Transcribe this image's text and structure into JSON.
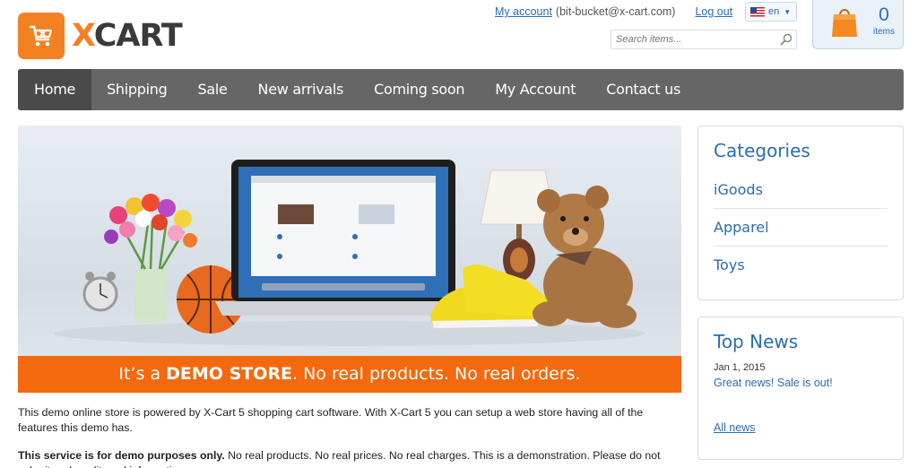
{
  "brand": {
    "name_part1": "X",
    "name_part2": "CART",
    "accent": "#f48024"
  },
  "header": {
    "my_account": "My account",
    "email": "(bit-bucket@x-cart.com)",
    "logout": "Log out",
    "language": "en",
    "search_placeholder": "Search items...",
    "cart_count": "0",
    "cart_items_label": "items"
  },
  "nav": {
    "items": [
      "Home",
      "Shipping",
      "Sale",
      "New arrivals",
      "Coming soon",
      "My Account",
      "Contact us"
    ],
    "active": "Home",
    "color": "#666666"
  },
  "banner": {
    "prefix": "It’s a ",
    "highlight": "DEMO STORE",
    "suffix": ". No real products. No real orders.",
    "bar_color": "#f4690e"
  },
  "content": {
    "para1": "This demo online store is powered by X-Cart 5 shopping cart software. With X-Cart 5 you can setup a web store having all of the features this demo has.",
    "para2_bold": "This service is for demo purposes only.",
    "para2_rest": " No real products. No real prices. No real charges. This is a demonstration. Please do not submit real credit card information."
  },
  "sidebar": {
    "categories_title": "Categories",
    "categories": [
      "iGoods",
      "Apparel",
      "Toys"
    ],
    "news_title": "Top News",
    "news_date": "Jan 1, 2015",
    "news_item": "Great news! Sale is out!",
    "all_news": "All news"
  },
  "colors": {
    "link": "#2a6cb5"
  }
}
